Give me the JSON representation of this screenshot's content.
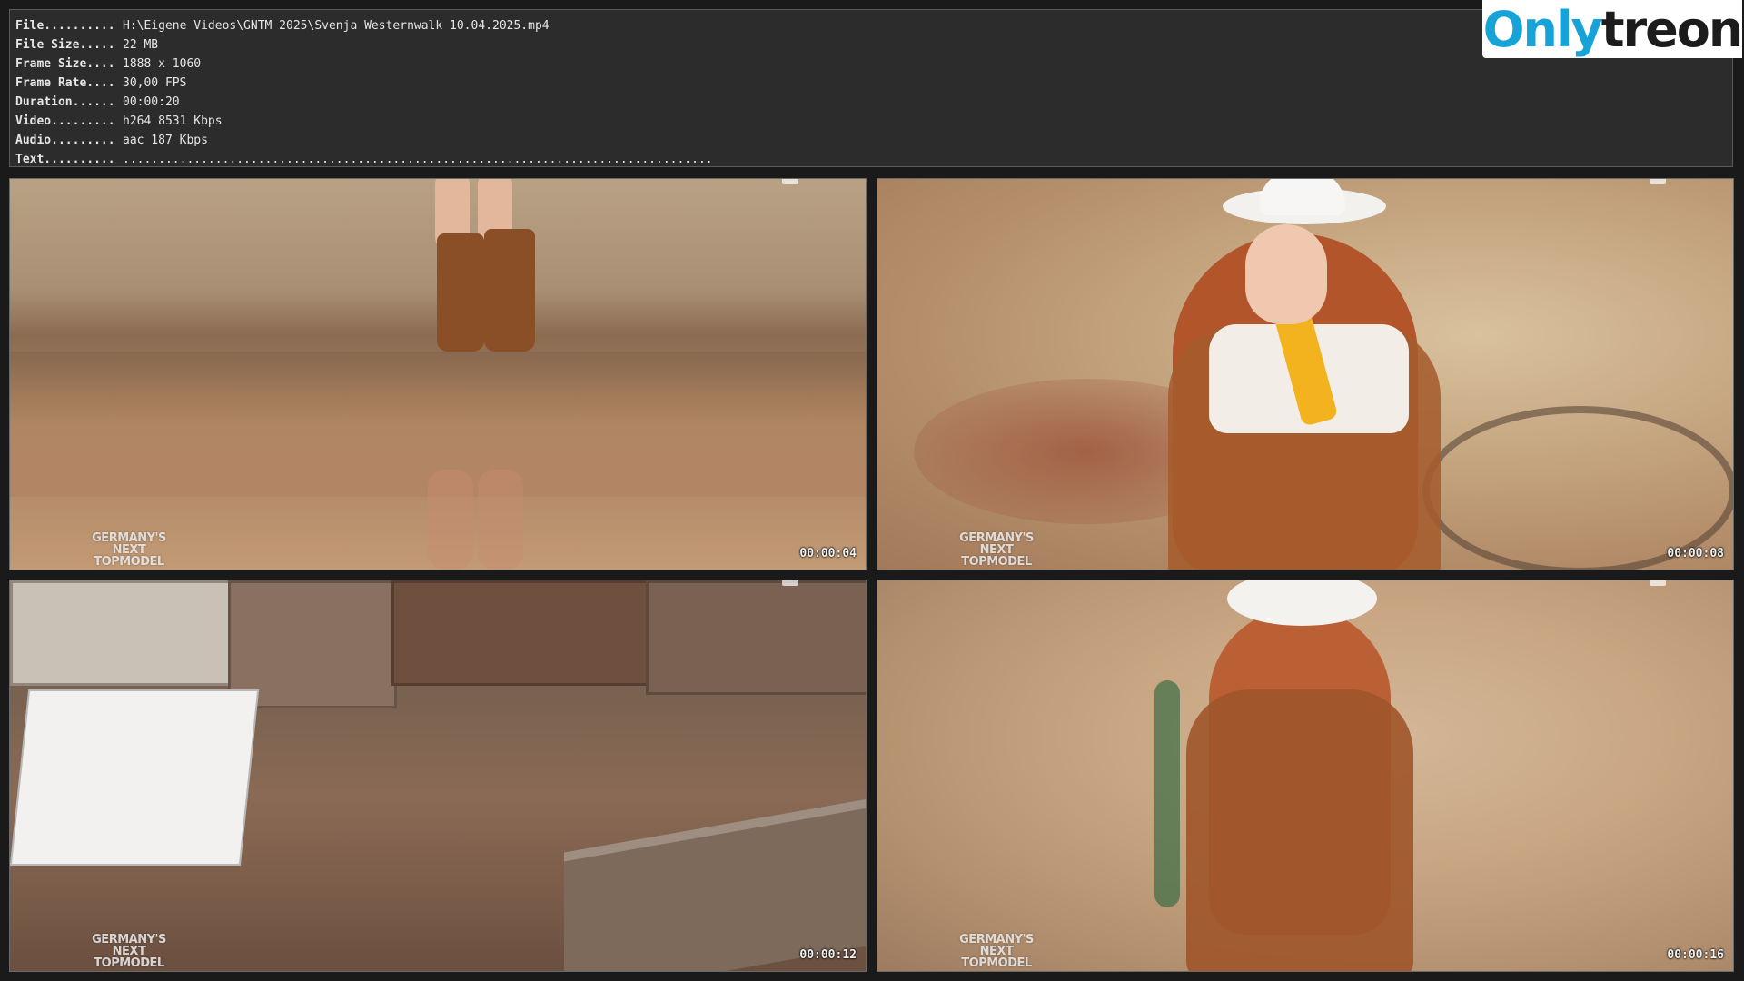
{
  "info": {
    "rows": [
      {
        "label": "File..........",
        "value": "H:\\Eigene Videos\\GNTM 2025\\Svenja Westernwalk 10.04.2025.mp4"
      },
      {
        "label": "File Size.....",
        "value": "22 MB"
      },
      {
        "label": "Frame Size....",
        "value": "1888 x 1060"
      },
      {
        "label": "Frame Rate....",
        "value": "30,00 FPS"
      },
      {
        "label": "Duration......",
        "value": "00:00:20"
      },
      {
        "label": "Video.........",
        "value": "h264 8531 Kbps"
      },
      {
        "label": "Audio.........",
        "value": "aac 187 Kbps"
      },
      {
        "label": "Text..........",
        "value": "..................................................................................."
      }
    ]
  },
  "watermark": {
    "part1": "Only",
    "part2": "treon"
  },
  "thumbnails": [
    {
      "timestamp": "00:00:04",
      "logo": [
        "GERMANY'S",
        "NEXT",
        "TOPMODEL"
      ]
    },
    {
      "timestamp": "00:00:08",
      "logo": [
        "GERMANY'S",
        "NEXT",
        "TOPMODEL"
      ]
    },
    {
      "timestamp": "00:00:12",
      "logo": [
        "GERMANY'S",
        "NEXT",
        "TOPMODEL"
      ]
    },
    {
      "timestamp": "00:00:16",
      "logo": [
        "GERMANY'S",
        "NEXT",
        "TOPMODEL"
      ]
    }
  ],
  "colors": {
    "panel_bg": "#2c2c2c",
    "panel_text": "#e6e6e6",
    "watermark_blue": "#17a3d8",
    "watermark_dark": "#1c1c1c"
  }
}
